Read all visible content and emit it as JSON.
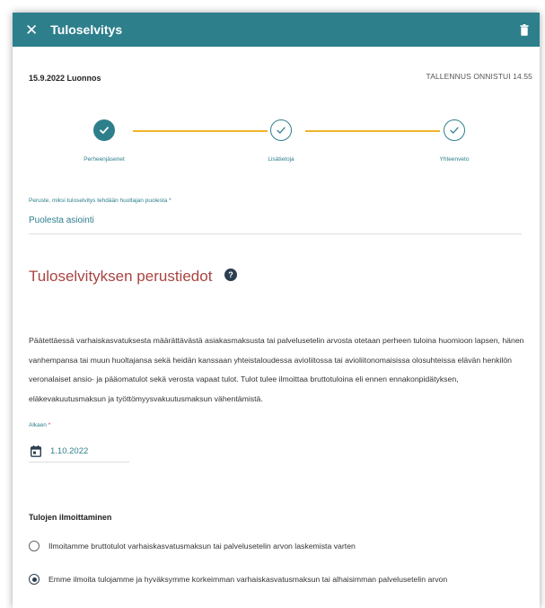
{
  "header": {
    "title": "Tuloselvitys",
    "close_icon": "close-icon",
    "delete_icon": "trash-icon",
    "color": "#2e7f8c"
  },
  "meta": {
    "draft_label": "15.9.2022 Luonnos",
    "save_status": "TALLENNUS ONNISTUI 14.55"
  },
  "stepper": {
    "steps": [
      {
        "label": "Perheenjäsenet",
        "state": "done"
      },
      {
        "label": "Lisätietoja",
        "state": "todo"
      },
      {
        "label": "Yhteenveto",
        "state": "todo"
      }
    ],
    "line_color": "#f0b429"
  },
  "reason": {
    "label": "Peruste, miksi tuloselvitys tehdään huoltajan puolesta *",
    "value": "Puolesta asiointi"
  },
  "basics": {
    "title": "Tuloselvityksen perustiedot",
    "help_icon": "help-icon",
    "description": "Päätettäessä varhaiskasvatuksesta määrättävästä asiakasmaksusta tai palvelusetelin arvosta otetaan perheen tuloina huomioon lapsen, hänen vanhempansa tai muun huoltajansa sekä heidän kanssaan yhteistaloudessa avioliitossa tai avioliitonomaisissa olosuhteissa elävän henkilön veronalaiset ansio- ja pääomatulot sekä verosta vapaat tulot. Tulot tulee ilmoittaa bruttotuloina eli ennen ennakonpidätyksen, eläkevakuutusmaksun ja työttömyysvakuutusmaksun vähentämistä."
  },
  "start_date": {
    "label": "Alkaen",
    "required_mark": "*",
    "value": "1.10.2022",
    "icon": "calendar-icon"
  },
  "income_reporting": {
    "title": "Tulojen ilmoittaminen",
    "options": [
      {
        "label": "Ilmoitamme bruttotulot varhaiskasvatusmaksun tai palvelusetelin arvon laskemista varten",
        "checked": false
      },
      {
        "label": "Emme ilmoita tulojamme ja hyväksymme korkeimman varhaiskasvatusmaksun tai alhaisimman palvelusetelin arvon",
        "checked": true
      }
    ]
  }
}
